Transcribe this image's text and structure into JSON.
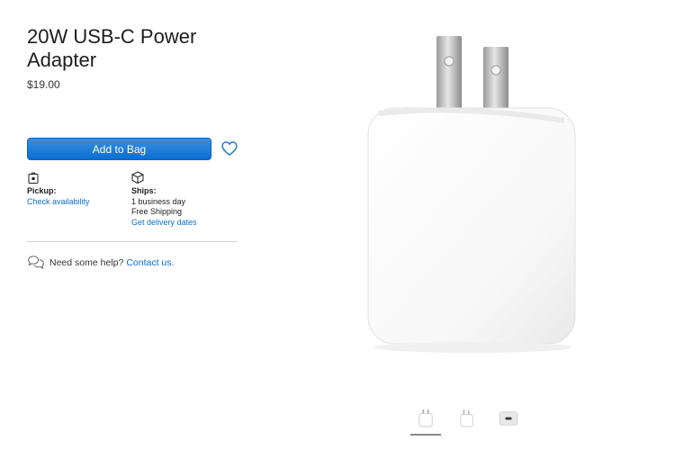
{
  "product": {
    "title": "20W USB-C Power Adapter",
    "price": "$19.00"
  },
  "actions": {
    "add_to_bag": "Add to Bag",
    "favorite_icon": "heart-icon"
  },
  "pickup": {
    "icon": "store-bag-icon",
    "label": "Pickup:",
    "link": "Check availability"
  },
  "shipping": {
    "icon": "box-icon",
    "label": "Ships:",
    "line1": "1 business day",
    "line2": "Free Shipping",
    "link": "Get delivery dates"
  },
  "help": {
    "icon": "chat-bubbles-icon",
    "text": "Need some help?",
    "link": "Contact us."
  },
  "gallery": {
    "selected_index": 0,
    "thumbnails": [
      "adapter-front",
      "adapter-angle",
      "adapter-port"
    ]
  },
  "colors": {
    "accent": "#0071e3",
    "link": "#0b6ec9",
    "text": "#1d1d1f"
  }
}
